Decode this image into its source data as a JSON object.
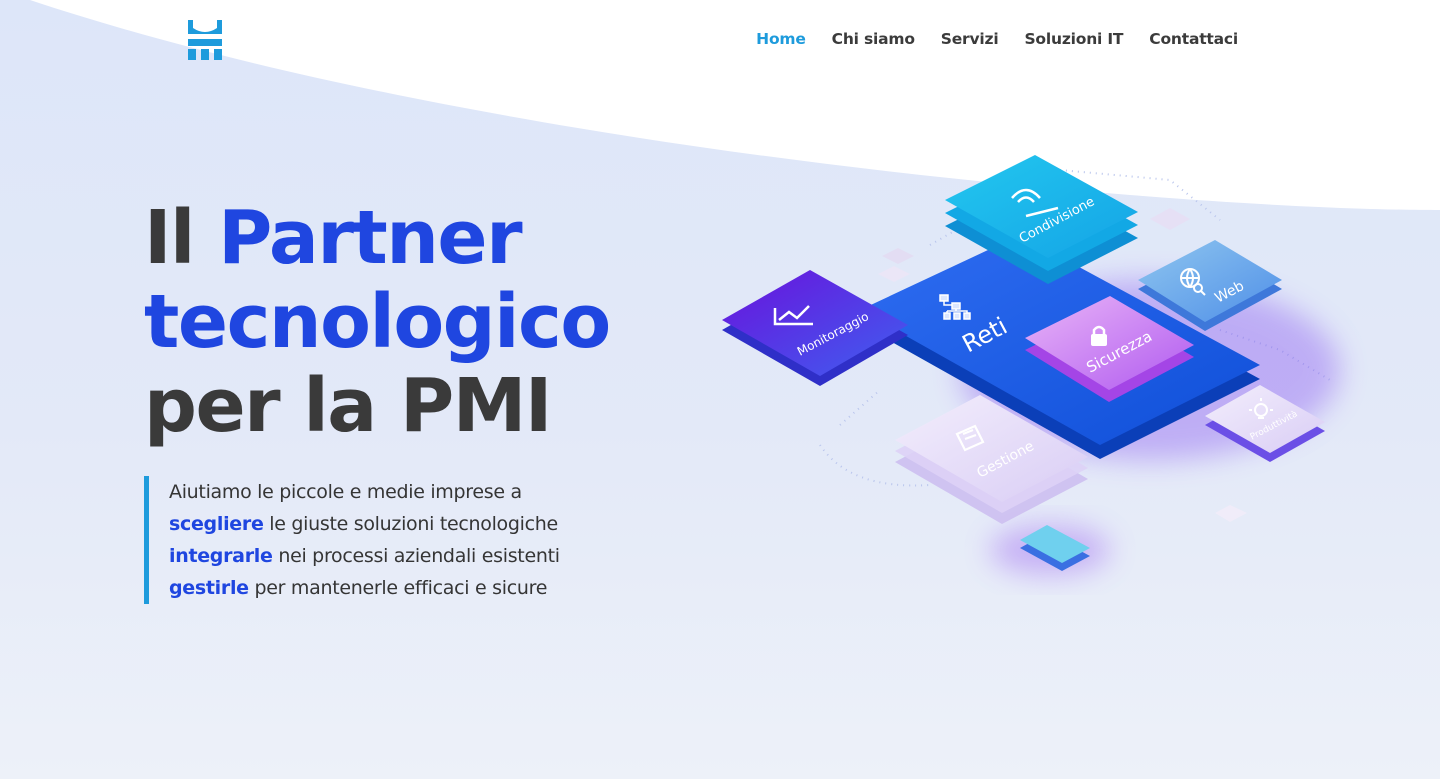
{
  "nav": {
    "items": [
      {
        "label": "Home",
        "active": true
      },
      {
        "label": "Chi siamo",
        "active": false
      },
      {
        "label": "Servizi",
        "active": false
      },
      {
        "label": "Soluzioni IT",
        "active": false
      },
      {
        "label": "Contattaci",
        "active": false
      }
    ]
  },
  "logo": {
    "icon": "castle-crown-logo-icon",
    "color": "#1e9bdc"
  },
  "hero": {
    "title_part1": "Il",
    "title_part2": "Partner",
    "title_part3": "tecnologico",
    "title_part4": "per la PMI"
  },
  "intro": {
    "line1": "Aiutiamo le piccole e medie imprese a",
    "kw1": "scegliere",
    "rest1": "le giuste soluzioni tecnologiche",
    "kw2": "integrarle",
    "rest2": "nei processi aziendali esistenti",
    "kw3": "gestirle",
    "rest3": "per mantenerle efficaci e sicure"
  },
  "illustration": {
    "center": "Reti",
    "tiles": [
      "Condivisione",
      "Monitoraggio",
      "Web",
      "Sicurezza",
      "Gestione",
      "Produttività"
    ]
  },
  "colors": {
    "accent": "#1e9bdc",
    "primary_blue": "#1f46e0",
    "text": "#3a3a3a"
  }
}
